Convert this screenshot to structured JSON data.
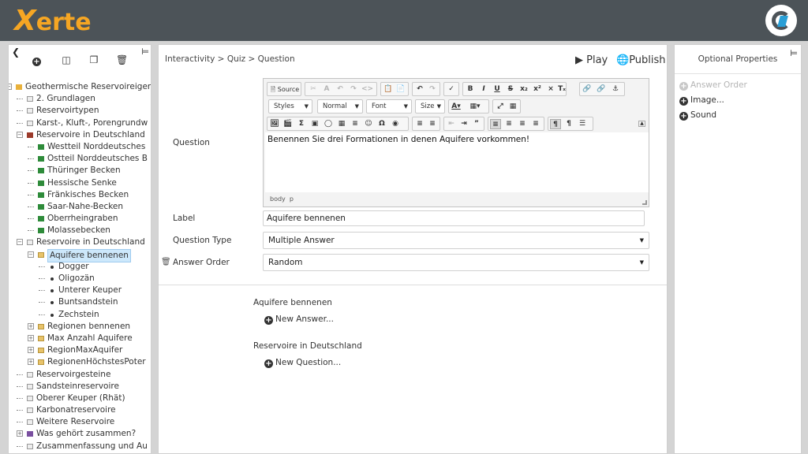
{
  "header": {
    "logo_text": "erte",
    "logo_x": "X",
    "brand_color": "#f6a623",
    "bar_color": "#4c5358"
  },
  "left_toolbar": {
    "collapse_icon": "chevron-left-icon",
    "pin_icon": "pin-icon",
    "buttons": [
      "add-icon",
      "copy-icon",
      "duplicate-icon",
      "delete-icon"
    ]
  },
  "tree": [
    {
      "label": "Geothermische Reservoireigen",
      "icon": "cube"
    },
    {
      "label": "2. Grundlagen",
      "icon": "page"
    },
    {
      "label": "Reservoirtypen",
      "icon": "page"
    },
    {
      "label": "Karst-, Kluft-, Porengrundw",
      "icon": "page"
    },
    {
      "label": "Reservoire in Deutschland",
      "icon": "red"
    },
    {
      "label": "Westteil Norddeutsches",
      "icon": "green"
    },
    {
      "label": "Ostteil Norddeutsches B",
      "icon": "green"
    },
    {
      "label": "Thüringer Becken",
      "icon": "green"
    },
    {
      "label": "Hessische Senke",
      "icon": "green"
    },
    {
      "label": "Fränkisches Becken",
      "icon": "green"
    },
    {
      "label": "Saar-Nahe-Becken",
      "icon": "green"
    },
    {
      "label": "Oberrheingraben",
      "icon": "green"
    },
    {
      "label": "Molassebecken",
      "icon": "green"
    },
    {
      "label": "Reservoire in Deutschland",
      "icon": "page"
    },
    {
      "label": "Aquifere bennenen",
      "icon": "folder"
    },
    {
      "label": "Dogger",
      "icon": "dot"
    },
    {
      "label": "Oligozän",
      "icon": "dot"
    },
    {
      "label": "Unterer Keuper",
      "icon": "dot"
    },
    {
      "label": "Buntsandstein",
      "icon": "dot"
    },
    {
      "label": "Zechstein",
      "icon": "dot"
    },
    {
      "label": "Regionen bennenen",
      "icon": "folder"
    },
    {
      "label": "Max Anzahl Aquifere",
      "icon": "folder"
    },
    {
      "label": "RegionMaxAquifer",
      "icon": "folder"
    },
    {
      "label": "RegionenHöchstesPoter",
      "icon": "folder"
    },
    {
      "label": "Reservoirgesteine",
      "icon": "page"
    },
    {
      "label": "Sandsteinreservoire",
      "icon": "page"
    },
    {
      "label": "Oberer Keuper (Rhät)",
      "icon": "page"
    },
    {
      "label": "Karbonatreservoire",
      "icon": "page"
    },
    {
      "label": "Weitere Reservoire",
      "icon": "page"
    },
    {
      "label": "Was gehört zusammen?",
      "icon": "rocket"
    },
    {
      "label": "Zusammenfassung und Au",
      "icon": "page"
    }
  ],
  "center": {
    "breadcrumb": "Interactivity > Quiz > Question",
    "play_label": "Play",
    "publish_label": "Publish",
    "editor": {
      "source_label": "Source",
      "styles_label": "Styles",
      "format_label": "Normal",
      "font_label": "Font",
      "size_label": "Size",
      "content": "Benennen Sie drei Formationen in denen Aquifere vorkommen!",
      "path_body": "body",
      "path_p": "p"
    },
    "question_label": "Question",
    "label_label": "Label",
    "label_value": "Aquifere bennenen",
    "question_type_label": "Question Type",
    "question_type_value": "Multiple Answer",
    "answer_order_label": "Answer Order",
    "answer_order_value": "Random",
    "answers_section_title": "Aquifere bennenen",
    "new_answer_label": "New Answer...",
    "questions_section_title": "Reservoire in Deutschland",
    "new_question_label": "New Question..."
  },
  "right": {
    "title": "Optional Properties",
    "items": [
      {
        "label": "Answer Order",
        "disabled": true
      },
      {
        "label": "Image...",
        "disabled": false
      },
      {
        "label": "Sound",
        "disabled": false
      }
    ]
  }
}
